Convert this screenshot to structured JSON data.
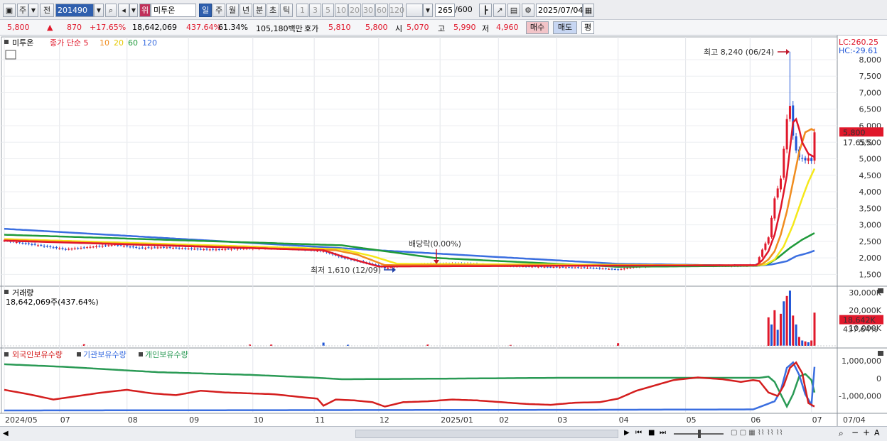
{
  "toolbar": {
    "type_label": "주",
    "prev_label": "전",
    "code": "201490",
    "badge": "위",
    "stock_name": "미투온",
    "periods": [
      "일",
      "주",
      "월",
      "년",
      "분",
      "초",
      "틱"
    ],
    "active_period": "일",
    "minute_steps": [
      "1",
      "3",
      "5",
      "10",
      "20",
      "30",
      "60",
      "120"
    ],
    "count": "265",
    "count_max": "/600",
    "date": "2025/07/04"
  },
  "quote": {
    "price": "5,800",
    "change": "870",
    "change_pct": "+17.65%",
    "volume": "18,642,069",
    "volume_pct": "437.64%",
    "turnover_pct": "61.34%",
    "amount": "105,180백만",
    "bid_label": "호가",
    "bid1": "5,810",
    "bid2": "5,800",
    "open_label": "시",
    "open": "5,070",
    "high_label": "고",
    "high": "5,990",
    "low_label": "저",
    "low": "4,960",
    "buy_label": "매수",
    "sell_label": "매도",
    "eval_label": "평"
  },
  "colors": {
    "up": "#e0182b",
    "down": "#1f55d6",
    "ma5": "#e0182b",
    "ma10": "#f08c1e",
    "ma20": "#f5e81a",
    "ma60": "#1f9a3a",
    "ma120": "#3a6ee0",
    "foreign": "#d41e1e",
    "institution": "#3a6ee0",
    "individual": "#2a9a55"
  },
  "chart_data": [
    {
      "type": "line",
      "title": "미투온",
      "legend": [
        "종가 단순 5",
        "10",
        "20",
        "60",
        "120"
      ],
      "lc_label": "LC:260.25",
      "hc_label": "HC:-29.61",
      "ylim": [
        1250,
        8300
      ],
      "yticks": [
        "8,000",
        "7,500",
        "7,000",
        "6,500",
        "6,000",
        "5,500",
        "5,000",
        "4,500",
        "4,000",
        "3,500",
        "3,000",
        "2,500",
        "2,000",
        "1,500"
      ],
      "ytick_values": [
        8000,
        7500,
        7000,
        6500,
        6000,
        5500,
        5000,
        4500,
        4000,
        3500,
        3000,
        2500,
        2000,
        1500
      ],
      "current_price": "5,800",
      "current_pct": "17.65%",
      "xticks": [
        "2024/05",
        "07",
        "08",
        "09",
        "10",
        "11",
        "12",
        "2025/01",
        "02",
        "03",
        "04",
        "05",
        "06",
        "07"
      ],
      "xtick_idx": [
        0,
        18,
        40,
        60,
        81,
        101,
        122,
        142,
        161,
        180,
        200,
        222,
        243,
        263
      ],
      "last_axis_label": "07/04",
      "annotations": {
        "high": "최고 8,240 (06/24)",
        "low": "최저 1,610 (12/09)",
        "dividend": "배당락(0.00%)"
      },
      "close_anchors": [
        [
          0,
          2530
        ],
        [
          20,
          2260
        ],
        [
          36,
          2400
        ],
        [
          44,
          2300
        ],
        [
          52,
          2320
        ],
        [
          60,
          2280
        ],
        [
          68,
          2250
        ],
        [
          76,
          2280
        ],
        [
          84,
          2300
        ],
        [
          92,
          2290
        ],
        [
          100,
          2240
        ],
        [
          104,
          2200
        ],
        [
          110,
          2010
        ],
        [
          122,
          1760
        ],
        [
          124,
          1680
        ],
        [
          130,
          1790
        ],
        [
          140,
          1820
        ],
        [
          150,
          1830
        ],
        [
          160,
          1770
        ],
        [
          170,
          1740
        ],
        [
          180,
          1720
        ],
        [
          190,
          1700
        ],
        [
          200,
          1650
        ],
        [
          205,
          1720
        ],
        [
          210,
          1760
        ],
        [
          220,
          1770
        ],
        [
          230,
          1760
        ],
        [
          240,
          1760
        ],
        [
          245,
          1790
        ],
        [
          247,
          2250
        ],
        [
          249,
          2620
        ],
        [
          251,
          3800
        ],
        [
          253,
          4400
        ],
        [
          254,
          5300
        ],
        [
          255,
          6200
        ],
        [
          256,
          6600
        ],
        [
          257,
          5700
        ],
        [
          258,
          5250
        ],
        [
          259,
          5050
        ],
        [
          260,
          5000
        ],
        [
          261,
          4950
        ],
        [
          262,
          5020
        ],
        [
          263,
          4930
        ],
        [
          264,
          5800
        ]
      ],
      "ma5_anchors": [
        [
          0,
          2520
        ],
        [
          104,
          2230
        ],
        [
          110,
          2050
        ],
        [
          122,
          1740
        ],
        [
          245,
          1780
        ],
        [
          247,
          1930
        ],
        [
          249,
          2200
        ],
        [
          251,
          2700
        ],
        [
          253,
          3500
        ],
        [
          255,
          4500
        ],
        [
          256,
          5300
        ],
        [
          257,
          6100
        ],
        [
          258,
          6200
        ],
        [
          259,
          5900
        ],
        [
          260,
          5500
        ],
        [
          262,
          5150
        ],
        [
          264,
          5050
        ]
      ],
      "ma10_anchors": [
        [
          0,
          2540
        ],
        [
          108,
          2230
        ],
        [
          115,
          2100
        ],
        [
          124,
          1780
        ],
        [
          245,
          1770
        ],
        [
          247,
          1820
        ],
        [
          249,
          1950
        ],
        [
          251,
          2200
        ],
        [
          253,
          2700
        ],
        [
          255,
          3400
        ],
        [
          257,
          4300
        ],
        [
          259,
          5200
        ],
        [
          261,
          5800
        ],
        [
          263,
          5900
        ],
        [
          264,
          5850
        ]
      ],
      "ma20_anchors": [
        [
          0,
          2570
        ],
        [
          110,
          2260
        ],
        [
          120,
          2050
        ],
        [
          128,
          1820
        ],
        [
          245,
          1770
        ],
        [
          248,
          1800
        ],
        [
          251,
          1950
        ],
        [
          254,
          2350
        ],
        [
          257,
          3000
        ],
        [
          260,
          3800
        ],
        [
          262,
          4300
        ],
        [
          264,
          4700
        ]
      ],
      "ma60_anchors": [
        [
          0,
          2700
        ],
        [
          110,
          2380
        ],
        [
          140,
          2000
        ],
        [
          200,
          1730
        ],
        [
          245,
          1760
        ],
        [
          249,
          1820
        ],
        [
          252,
          2000
        ],
        [
          256,
          2300
        ],
        [
          260,
          2550
        ],
        [
          264,
          2750
        ]
      ],
      "ma120_anchors": [
        [
          0,
          2880
        ],
        [
          120,
          2240
        ],
        [
          200,
          1820
        ],
        [
          245,
          1760
        ],
        [
          250,
          1800
        ],
        [
          255,
          1900
        ],
        [
          258,
          2050
        ],
        [
          262,
          2150
        ],
        [
          264,
          2220
        ]
      ]
    },
    {
      "type": "bar",
      "title": "거래량",
      "info": "18,642,069주(437.64%)",
      "yticks": [
        "30,000K",
        "20,000K",
        "10,000K"
      ],
      "ytick_values": [
        30000,
        20000,
        10000
      ],
      "ylim": [
        0,
        31500
      ],
      "current_value": "18,642K",
      "current_pct": "437.64%",
      "volume_k": [
        [
          249,
          16000,
          "up"
        ],
        [
          250,
          12000,
          "down"
        ],
        [
          251,
          20000,
          "up"
        ],
        [
          252,
          9000,
          "down"
        ],
        [
          253,
          18000,
          "up"
        ],
        [
          254,
          25000,
          "down"
        ],
        [
          255,
          28000,
          "up"
        ],
        [
          256,
          31000,
          "down"
        ],
        [
          257,
          17000,
          "up"
        ],
        [
          258,
          12000,
          "down"
        ],
        [
          259,
          5000,
          "up"
        ],
        [
          260,
          3000,
          "down"
        ],
        [
          261,
          2500,
          "up"
        ],
        [
          262,
          2000,
          "down"
        ],
        [
          263,
          3000,
          "up"
        ],
        [
          264,
          18642,
          "up"
        ]
      ],
      "small_marks": [
        [
          26,
          900,
          "up"
        ],
        [
          80,
          700,
          "up"
        ],
        [
          87,
          700,
          "up"
        ],
        [
          104,
          1800,
          "down"
        ],
        [
          112,
          600,
          "down"
        ],
        [
          138,
          700,
          "up"
        ],
        [
          165,
          500,
          "up"
        ],
        [
          200,
          1500,
          "up"
        ]
      ]
    },
    {
      "type": "line",
      "title": "외국인보유수량 · 기관보유수량 · 개인보유수량",
      "legend": [
        "외국인보유수량",
        "기관보유수량",
        "개인보유수량"
      ],
      "ylim": [
        -1900000,
        1400000
      ],
      "yticks": [
        "1,000,000",
        "0",
        "-1,000,000"
      ],
      "ytick_values": [
        1000000,
        0,
        -1000000
      ],
      "foreign_anchors": [
        [
          0,
          -650000
        ],
        [
          8,
          -900000
        ],
        [
          16,
          -1200000
        ],
        [
          24,
          -1000000
        ],
        [
          32,
          -800000
        ],
        [
          40,
          -650000
        ],
        [
          48,
          -850000
        ],
        [
          56,
          -950000
        ],
        [
          64,
          -700000
        ],
        [
          72,
          -800000
        ],
        [
          80,
          -850000
        ],
        [
          88,
          -900000
        ],
        [
          96,
          -1050000
        ],
        [
          102,
          -1150000
        ],
        [
          104,
          -1550000
        ],
        [
          108,
          -1200000
        ],
        [
          114,
          -1250000
        ],
        [
          120,
          -1350000
        ],
        [
          124,
          -1600000
        ],
        [
          130,
          -1350000
        ],
        [
          138,
          -1300000
        ],
        [
          146,
          -1200000
        ],
        [
          154,
          -1250000
        ],
        [
          162,
          -1350000
        ],
        [
          170,
          -1450000
        ],
        [
          178,
          -1500000
        ],
        [
          186,
          -1380000
        ],
        [
          194,
          -1350000
        ],
        [
          200,
          -1150000
        ],
        [
          206,
          -700000
        ],
        [
          212,
          -400000
        ],
        [
          218,
          -100000
        ],
        [
          226,
          50000
        ],
        [
          234,
          -50000
        ],
        [
          240,
          -200000
        ],
        [
          244,
          -100000
        ],
        [
          246,
          -150000
        ],
        [
          249,
          -800000
        ],
        [
          252,
          -1000000
        ],
        [
          254,
          -400000
        ],
        [
          256,
          600000
        ],
        [
          258,
          900000
        ],
        [
          260,
          300000
        ],
        [
          262,
          -1400000
        ],
        [
          264,
          -1600000
        ]
      ],
      "institution_anchors": [
        [
          0,
          -1820000
        ],
        [
          100,
          -1800000
        ],
        [
          200,
          -1780000
        ],
        [
          244,
          -1760000
        ],
        [
          248,
          -1500000
        ],
        [
          251,
          -1300000
        ],
        [
          253,
          -700000
        ],
        [
          255,
          600000
        ],
        [
          257,
          900000
        ],
        [
          259,
          200000
        ],
        [
          261,
          -900000
        ],
        [
          263,
          -1500000
        ],
        [
          264,
          650000
        ]
      ],
      "individual_anchors": [
        [
          0,
          800000
        ],
        [
          20,
          650000
        ],
        [
          50,
          350000
        ],
        [
          80,
          200000
        ],
        [
          100,
          50000
        ],
        [
          110,
          -50000
        ],
        [
          140,
          -20000
        ],
        [
          180,
          30000
        ],
        [
          220,
          30000
        ],
        [
          246,
          30000
        ],
        [
          249,
          100000
        ],
        [
          251,
          -200000
        ],
        [
          253,
          -900000
        ],
        [
          255,
          -1600000
        ],
        [
          257,
          -900000
        ],
        [
          259,
          100000
        ],
        [
          261,
          250000
        ],
        [
          263,
          -100000
        ],
        [
          264,
          -800000
        ]
      ]
    }
  ]
}
